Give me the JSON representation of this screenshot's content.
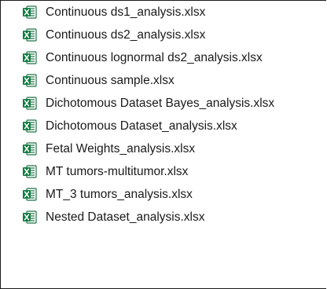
{
  "file_list": {
    "icon": "excel-file-icon",
    "icon_colors": {
      "sheet_green": "#1e7145",
      "tile_green": "#107c41",
      "text_white": "#ffffff"
    },
    "items": [
      {
        "name": "Continuous ds1_analysis.xlsx"
      },
      {
        "name": "Continuous ds2_analysis.xlsx"
      },
      {
        "name": "Continuous lognormal ds2_analysis.xlsx"
      },
      {
        "name": "Continuous sample.xlsx"
      },
      {
        "name": "Dichotomous Dataset Bayes_analysis.xlsx"
      },
      {
        "name": "Dichotomous Dataset_analysis.xlsx"
      },
      {
        "name": "Fetal Weights_analysis.xlsx"
      },
      {
        "name": "MT tumors-multitumor.xlsx"
      },
      {
        "name": "MT_3 tumors_analysis.xlsx"
      },
      {
        "name": "Nested Dataset_analysis.xlsx"
      }
    ]
  }
}
